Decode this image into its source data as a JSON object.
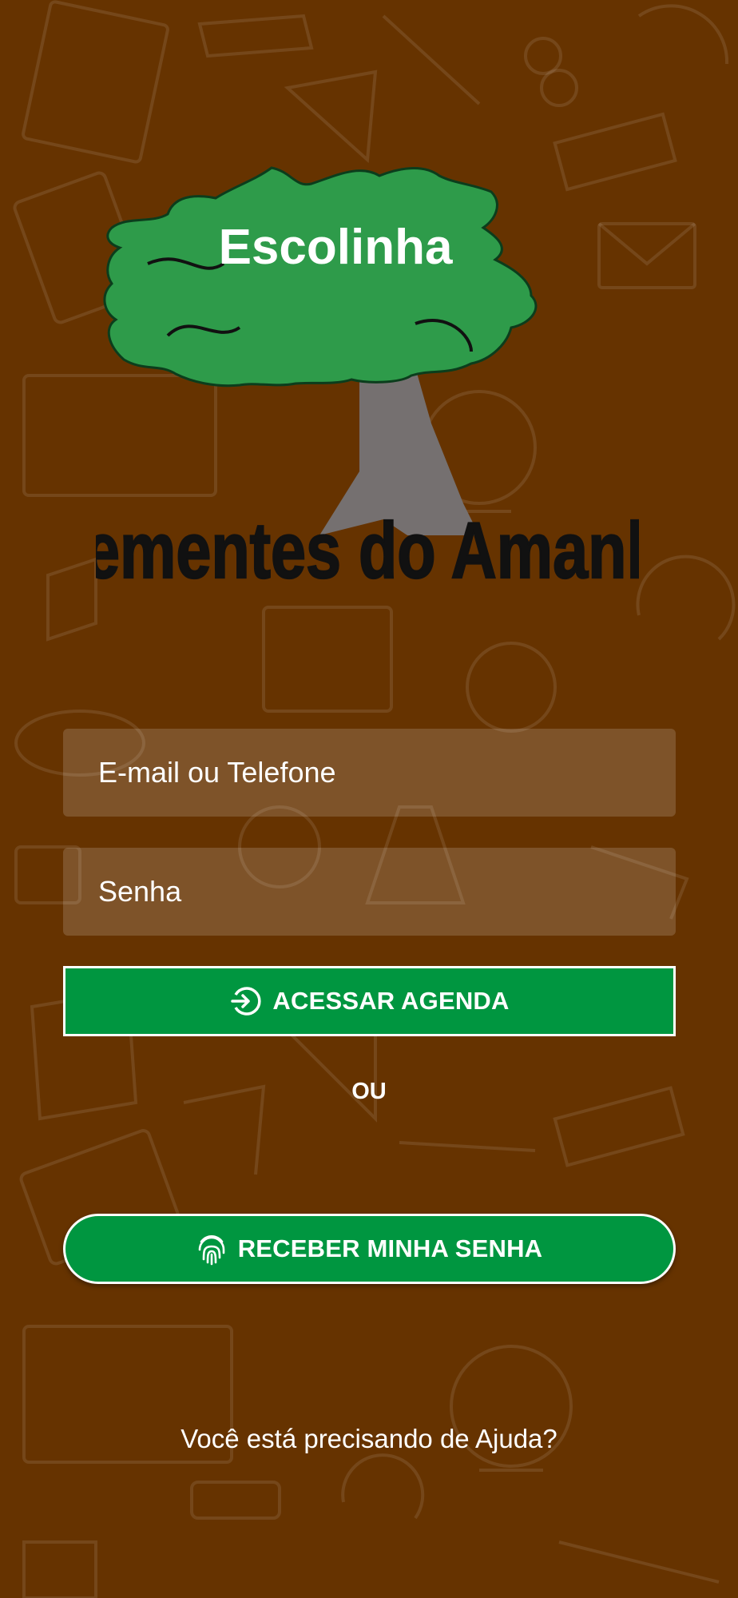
{
  "logo": {
    "top_text": "Escolinha",
    "bottom_text": "Sementes do Amanhã"
  },
  "form": {
    "email_placeholder": "E-mail ou Telefone",
    "password_placeholder": "Senha",
    "access_button_label": "ACESSAR AGENDA",
    "access_button_icon": "login-arrow-icon",
    "separator": "OU",
    "receive_password_label": "RECEBER MINHA SENHA",
    "receive_password_icon": "fingerprint-icon"
  },
  "help_link": "Você está precisando de Ajuda?",
  "colors": {
    "background": "#663300",
    "button_green": "#009640",
    "logo_tree_green": "#2e9b4a",
    "trunk_gray": "#757070"
  }
}
